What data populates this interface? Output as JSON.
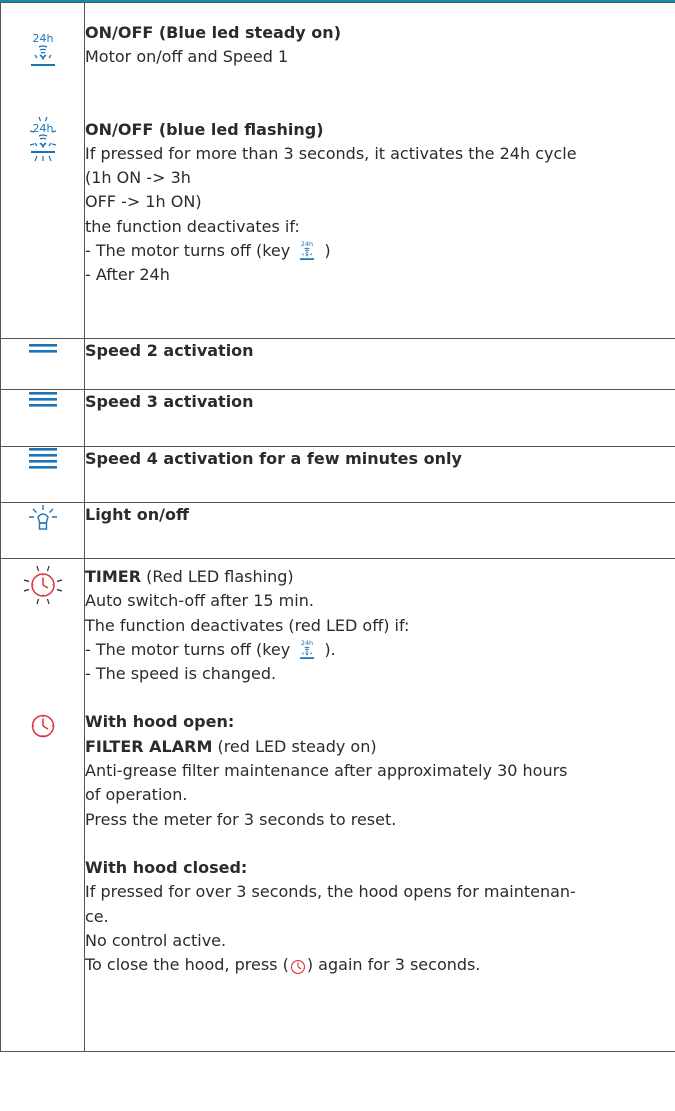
{
  "colors": {
    "icon_blue": "#1a74b8",
    "alarm_red": "#e0323c",
    "rule": "#0e8fa3",
    "text": "#2b2b2b"
  },
  "rows": [
    {
      "icons": [
        "fan-24h-icon",
        "fan-24h-flashing-icon"
      ],
      "block1": {
        "title": "ON/OFF (Blue led steady on)",
        "lines": [
          "Motor on/off and Speed 1"
        ]
      },
      "block2": {
        "title": "ON/OFF (blue led flashing)",
        "lines": [
          "If pressed for more than 3 seconds, it activates the 24h cycle",
          "(1h ON -> 3h",
          "OFF -> 1h ON)",
          "the function deactivates if:",
          "- The motor turns off (key",
          ")",
          "- After 24h"
        ]
      }
    },
    {
      "icon": "speed-2-icon",
      "label": "Speed 2 activation"
    },
    {
      "icon": "speed-3-icon",
      "label": "Speed 3 activation"
    },
    {
      "icon": "speed-4-icon",
      "label": "Speed 4 activation for a few minutes only"
    },
    {
      "icon": "light-bulb-icon",
      "label": "Light on/off"
    },
    {
      "icons": [
        "timer-flashing-icon",
        "timer-icon"
      ],
      "timer": {
        "title": "TIMER",
        "title_suffix": " (Red LED flashing)",
        "lines": [
          "Auto switch-off after 15 min.",
          "The function deactivates (red LED off) if:",
          "- The motor turns off (key",
          ").",
          "- The speed is changed."
        ]
      },
      "open": {
        "title": "With hood open:",
        "alarm_title": "FILTER ALARM",
        "alarm_suffix": " (red LED steady on)",
        "lines": [
          "Anti-grease filter maintenance after approximately 30 hours",
          "of operation.",
          "Press the meter for 3 seconds to reset."
        ]
      },
      "closed": {
        "title": "With hood closed:",
        "lines": [
          "If pressed for over 3 seconds, the hood opens for maintenan-",
          "ce.",
          "No control active.",
          "To close the hood, press (",
          ") again for 3 seconds."
        ]
      }
    }
  ]
}
